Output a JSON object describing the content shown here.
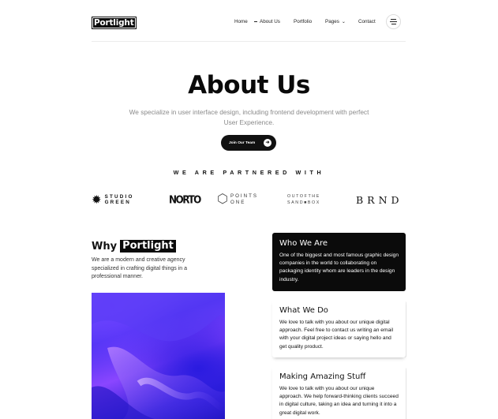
{
  "header": {
    "logo": "Portlight",
    "nav": [
      {
        "label": "Home"
      },
      {
        "label": "About Us"
      },
      {
        "label": "Portfolio"
      },
      {
        "label": "Pages"
      },
      {
        "label": "Contact"
      }
    ]
  },
  "hero": {
    "title": "About Us",
    "subtitle": "We specialize in user interface design, including frontend development with perfect User Experience.",
    "cta_label": "Join Our Team"
  },
  "partners": {
    "title": "WE ARE PARTNERED WITH",
    "logos": [
      {
        "line1": "STUDIO",
        "line2": "GREEN"
      },
      {
        "text": "NORTO"
      },
      {
        "line1": "POINTS",
        "line2": "ONE"
      },
      {
        "line1": "OUTOFTHE",
        "line2": "SAND■BOX"
      },
      {
        "text": "BRND"
      }
    ]
  },
  "why": {
    "title_prefix": "Why",
    "title_brand": "Portlight",
    "text": "We are a modern and creative agency specialized in crafting digital things in a professional manner."
  },
  "cards": [
    {
      "title": "Who We Are",
      "text": "One of the biggest and most famous graphic design companies in the world to collaborating on packaging  identity whom are leaders in the design industry."
    },
    {
      "title": "What We Do",
      "text": "We love to talk with you about our unique digital approach. Feel free to contact us writing an email with your digital project ideas or saying hello and get quality product."
    },
    {
      "title": "Making Amazing Stuff",
      "text": "We love to talk with you about our unique approach. We help forward-thinking clients succeed in digital culture, taking an idea and turning it into a great digital work."
    }
  ]
}
